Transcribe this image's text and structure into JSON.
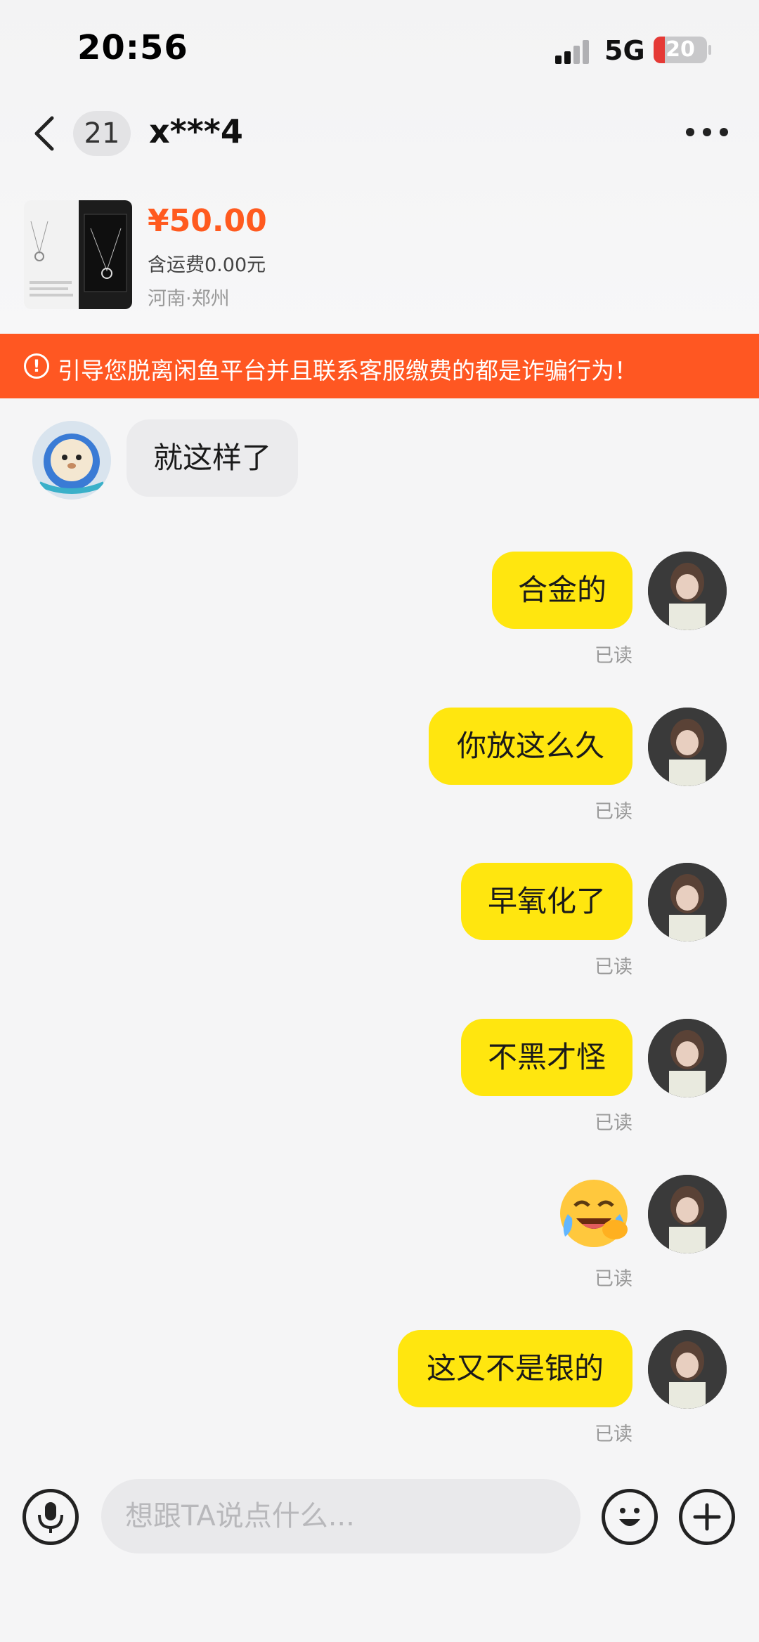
{
  "status_bar": {
    "time": "20:56",
    "network": "5G",
    "battery": "20"
  },
  "nav": {
    "unread_count": "21",
    "title": "x***4",
    "more_icon": "more-horizontal-icon",
    "back_icon": "chevron-left-icon"
  },
  "product": {
    "price": "¥50.00",
    "shipping": "含运费0.00元",
    "location": "河南·郑州"
  },
  "warning": {
    "icon": "warning-icon",
    "text": "引导您脱离闲鱼平台并且联系客服缴费的都是诈骗行为！"
  },
  "messages": [
    {
      "sender": "other",
      "text": "就这样了"
    },
    {
      "sender": "me",
      "text": "合金的",
      "status": "已读"
    },
    {
      "sender": "me",
      "text": "你放这么久",
      "status": "已读"
    },
    {
      "sender": "me",
      "text": "早氧化了",
      "status": "已读"
    },
    {
      "sender": "me",
      "text": "不黑才怪",
      "status": "已读"
    },
    {
      "sender": "me",
      "emoji": "laughing-crying-emoji",
      "status": "已读"
    },
    {
      "sender": "me",
      "text": "这又不是银的",
      "status": "已读"
    }
  ],
  "input": {
    "placeholder": "想跟TA说点什么...",
    "mic_icon": "microphone-icon",
    "emoji_icon": "smiley-icon",
    "plus_icon": "plus-icon"
  },
  "colors": {
    "accent_orange": "#ff5722",
    "price_orange": "#ff5a1f",
    "bubble_yellow": "#ffe60f",
    "bubble_gray": "#ebebed"
  }
}
